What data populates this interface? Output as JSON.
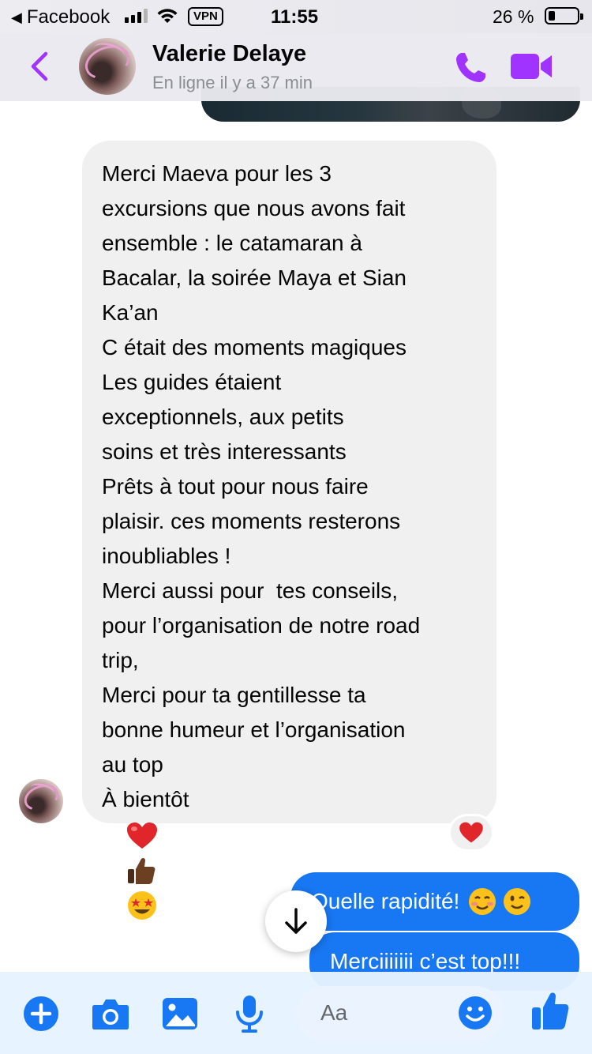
{
  "status_bar": {
    "back_app": "Facebook",
    "vpn": "VPN",
    "time": "11:55",
    "battery": "26 %"
  },
  "header": {
    "contact_name": "Valerie Delaye",
    "contact_status": "En ligne il y a 37 min",
    "accent_color": "#a033ff"
  },
  "received_message": {
    "lines": [
      "Merci Maeva pour les 3",
      "excursions que nous avons fait",
      "ensemble : le catamaran à",
      "Bacalar, la soirée Maya et Sian",
      "Ka’an",
      "C était des moments magiques",
      "Les guides étaient",
      "exceptionnels, aux petits",
      "soins et très interessants",
      "Prêts à tout pour nous faire",
      "plaisir. ces moments resterons",
      "inoubliables !",
      "Merci aussi pour  tes conseils,",
      "pour l’organisation de notre road",
      "trip,",
      "Merci pour ta gentillesse ta",
      "bonne humeur et l’organisation",
      "au top"
    ],
    "last_line_text": "À bientôt",
    "last_line_emojis": [
      "red-heart",
      "thumbs-up-dark",
      "star-struck"
    ],
    "reaction": "red-heart"
  },
  "sent_messages": [
    {
      "text": "Quelle rapidité!",
      "emojis": [
        "smiling-face",
        "winking-face"
      ]
    },
    {
      "text": "Merciiiiiii c’est top!!!",
      "emojis": []
    }
  ],
  "composer": {
    "placeholder": "Aa",
    "icons": [
      "plus-icon",
      "camera-icon",
      "gallery-icon",
      "microphone-icon",
      "emoji-icon",
      "like-icon"
    ],
    "accent_color": "#1877f2"
  }
}
